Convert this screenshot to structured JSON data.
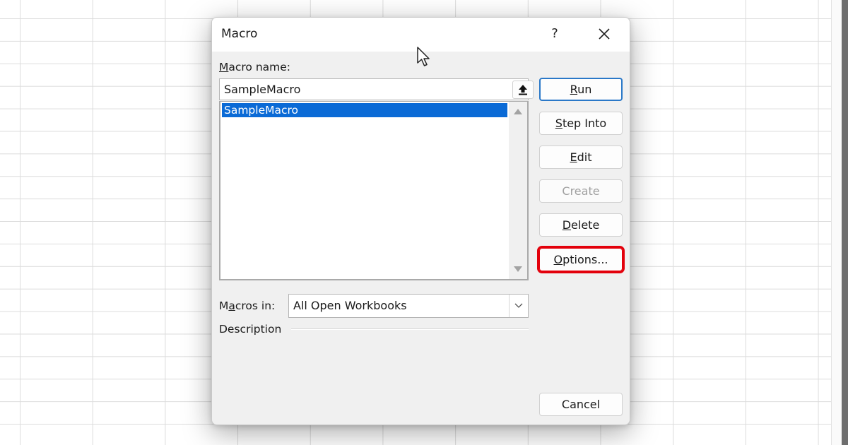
{
  "dialog": {
    "title": "Macro",
    "help_label": "?",
    "close_icon": "close-icon",
    "macro_name_label_accel": "M",
    "macro_name_label_rest": "acro name:",
    "macro_name_value": "SampleMacro",
    "upload_icon": "upload-arrow-icon",
    "macro_list": [
      {
        "name": "SampleMacro",
        "selected": true
      }
    ],
    "macros_in_label_pre": "M",
    "macros_in_label_accel": "a",
    "macros_in_label_rest": "cros in:",
    "macros_in_value": "All Open Workbooks",
    "description_label": "Description",
    "buttons": [
      {
        "accel": "R",
        "rest": "un",
        "pre": "",
        "state": "default"
      },
      {
        "accel": "S",
        "rest": "tep Into",
        "pre": "",
        "state": "normal"
      },
      {
        "accel": "E",
        "rest": "dit",
        "pre": "",
        "state": "normal"
      },
      {
        "accel": "",
        "rest": "Create",
        "pre": "",
        "state": "disabled"
      },
      {
        "accel": "D",
        "rest": "elete",
        "pre": "",
        "state": "normal"
      },
      {
        "accel": "O",
        "rest": "ptions...",
        "pre": "",
        "state": "highlighted"
      }
    ],
    "cancel_label": "Cancel",
    "highlight_color": "#e3000b",
    "selection_color": "#0a6ad6"
  }
}
